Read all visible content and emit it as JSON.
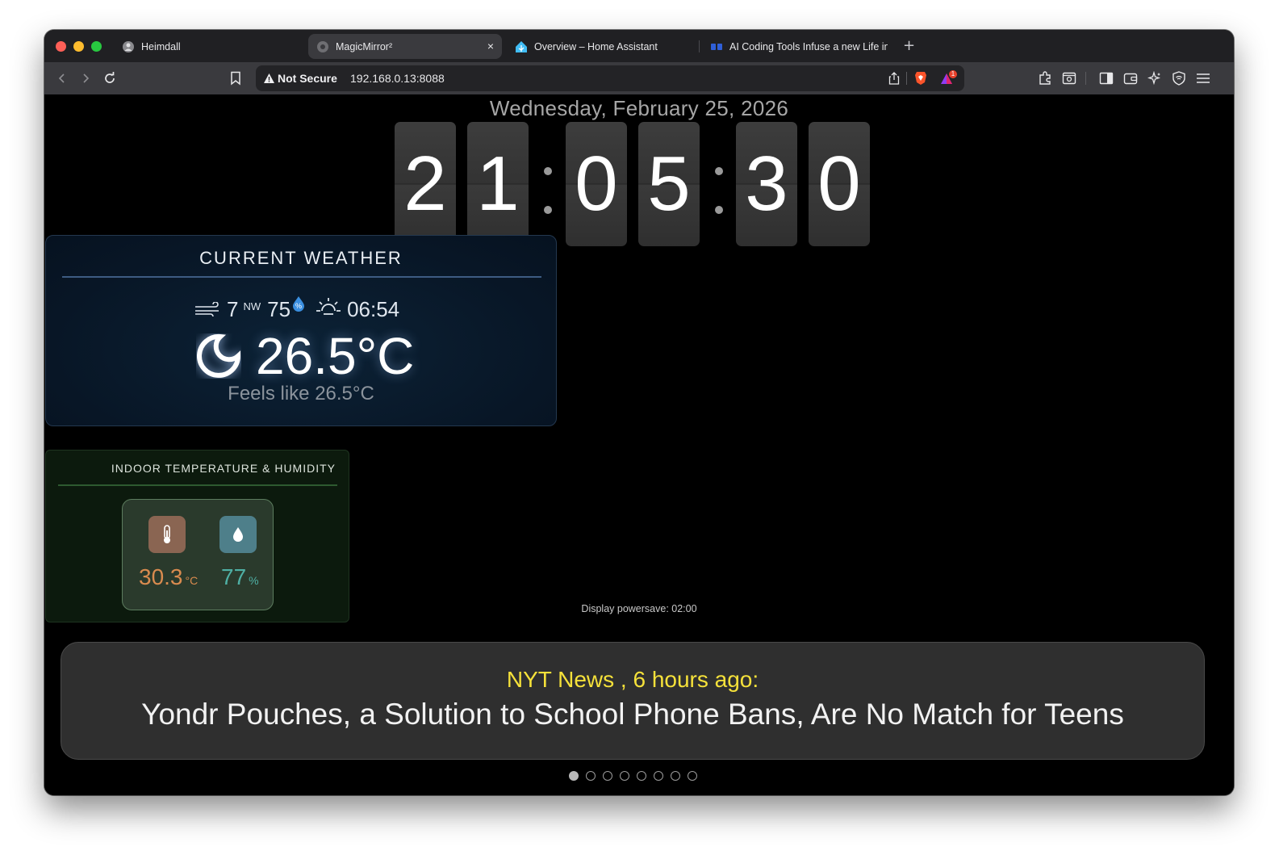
{
  "browser": {
    "tabs": [
      {
        "label": "Heimdall",
        "active": false
      },
      {
        "label": "MagicMirror²",
        "active": true
      },
      {
        "label": "Overview – Home Assistant",
        "active": false
      },
      {
        "label": "AI Coding Tools Infuse a new Life in",
        "active": false
      }
    ],
    "new_tab": "+",
    "close_tab": "×",
    "security_label": "Not Secure",
    "url": "192.168.0.13:8088",
    "notification_count": "1"
  },
  "clock": {
    "date": "Wednesday, February 25, 2026",
    "digits": [
      "2",
      "1",
      "0",
      "5",
      "3",
      "0"
    ]
  },
  "weather": {
    "title": "CURRENT WEATHER",
    "wind_speed": "7",
    "wind_dir": "NW",
    "humidity": "75",
    "sunrise": "06:54",
    "temperature": "26.5°C",
    "feels_like": "Feels like 26.5°C",
    "icon": "night-crescent-icon"
  },
  "indoor": {
    "title": "INDOOR TEMPERATURE & HUMIDITY",
    "temperature": "30.3",
    "temperature_unit": "°C",
    "humidity": "77",
    "humidity_unit": "%",
    "temp_color": "#d98b4f",
    "humidity_color": "#4fb0a5"
  },
  "powersave": "Display powersave: 02:00",
  "news": {
    "source": "NYT News , 6 hours ago:",
    "headline": "Yondr Pouches, a Solution to School Phone Bans, Are No Match for Teens",
    "page_count": 8,
    "current_page": 1
  }
}
